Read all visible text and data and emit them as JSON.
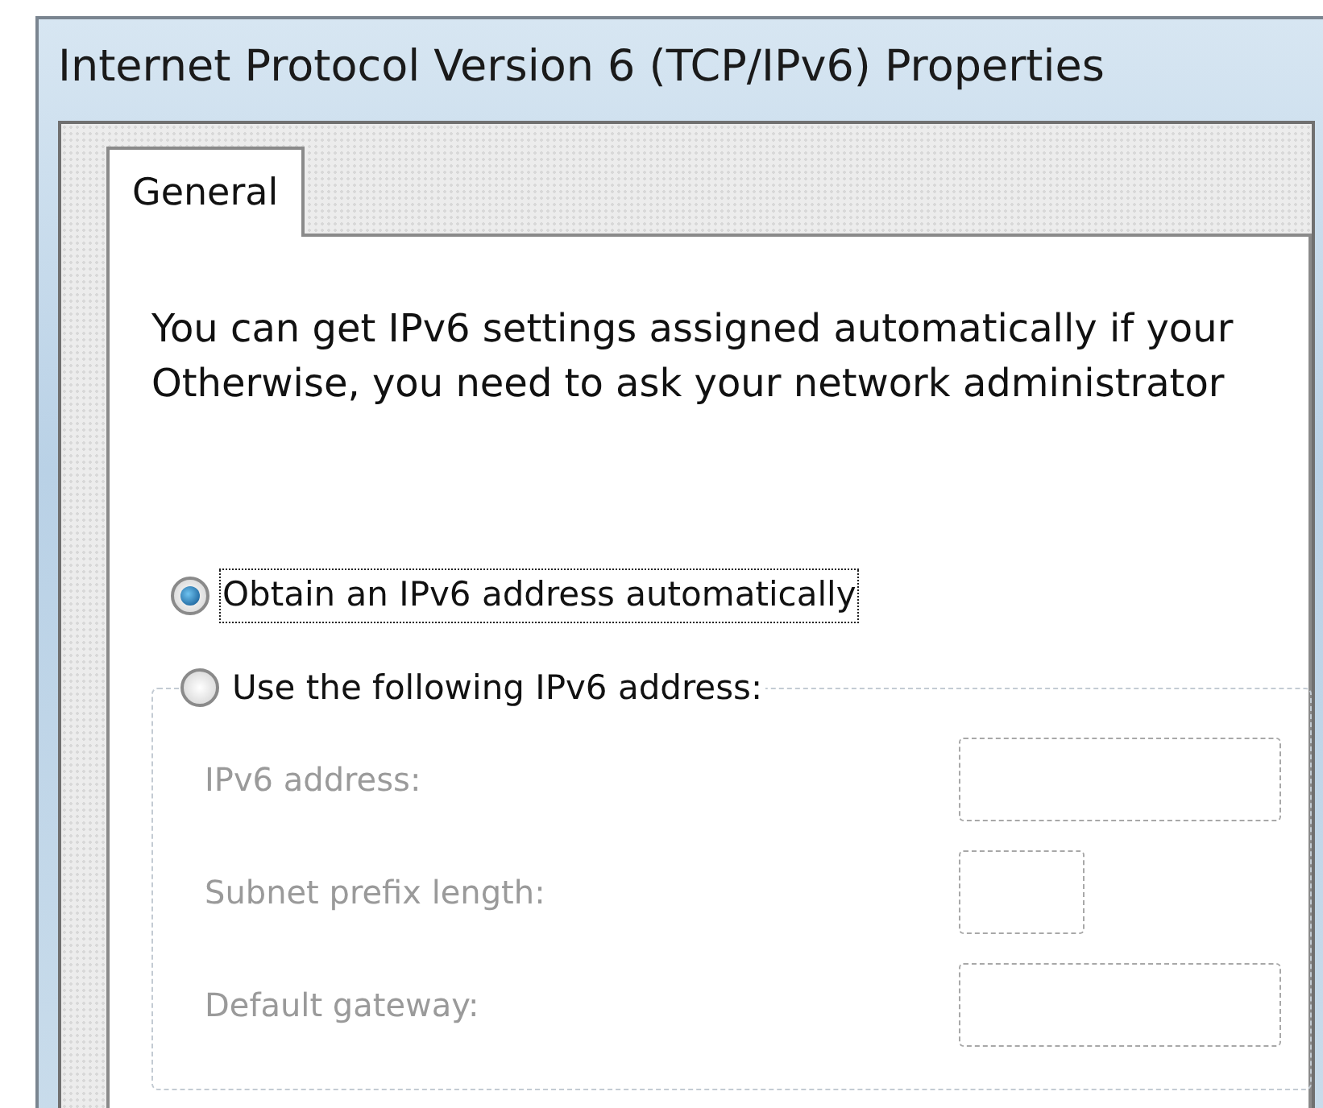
{
  "window": {
    "title": "Internet Protocol Version 6 (TCP/IPv6) Properties"
  },
  "tabs": [
    {
      "label": "General",
      "selected": true
    }
  ],
  "description": [
    "You can get IPv6 settings assigned automatically if your",
    "Otherwise, you need to ask your network administrator"
  ],
  "options": [
    {
      "label": "Obtain an IPv6 address automatically",
      "selected": true,
      "focused": true
    },
    {
      "label": "Use the following IPv6 address:",
      "selected": false,
      "focused": false
    }
  ],
  "fields": [
    {
      "label": "IPv6 address:",
      "kind": "address",
      "disabled": true
    },
    {
      "label": "Subnet prefix length:",
      "kind": "prefix",
      "disabled": true
    },
    {
      "label": "Default gateway:",
      "kind": "address",
      "disabled": true
    }
  ]
}
